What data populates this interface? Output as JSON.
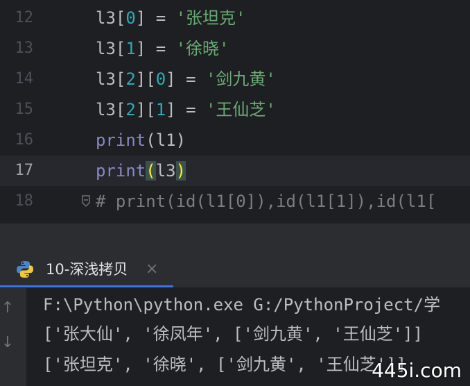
{
  "editor": {
    "lines": [
      {
        "num": "12",
        "parts": [
          "l3[",
          "0",
          "] = ",
          "'张坦克'"
        ]
      },
      {
        "num": "13",
        "parts": [
          "l3[",
          "1",
          "] = ",
          "'徐晓'"
        ]
      },
      {
        "num": "14",
        "parts": [
          "l3[",
          "2",
          "][",
          "0",
          "] = ",
          "'剑九黄'"
        ]
      },
      {
        "num": "15",
        "parts": [
          "l3[",
          "2",
          "][",
          "1",
          "] = ",
          "'王仙芝'"
        ]
      },
      {
        "num": "16",
        "builtin": "print",
        "args": "(l1)"
      },
      {
        "num": "17",
        "builtin": "print",
        "open": "(",
        "arg": "l3",
        "close": ")"
      },
      {
        "num": "18",
        "comment": "# print(id(l1[0]),id(l1[1]),id(l1["
      }
    ]
  },
  "run_panel": {
    "tab_label": "10-深浅拷贝",
    "close_glyph": "×",
    "up_glyph": "↑",
    "down_glyph": "↓",
    "output": [
      "F:\\Python\\python.exe G:/PythonProject/学",
      "['张大仙', '徐凤年', ['剑九黄', '王仙芝']]",
      "['张坦克', '徐晓', ['剑九黄', '王仙芝']]"
    ]
  },
  "watermark": "445i.com",
  "colors": {
    "editor_bg": "#1e1f22",
    "string": "#6aab73",
    "number": "#2aacb8",
    "builtin": "#8888c6",
    "accent": "#3574f0"
  }
}
